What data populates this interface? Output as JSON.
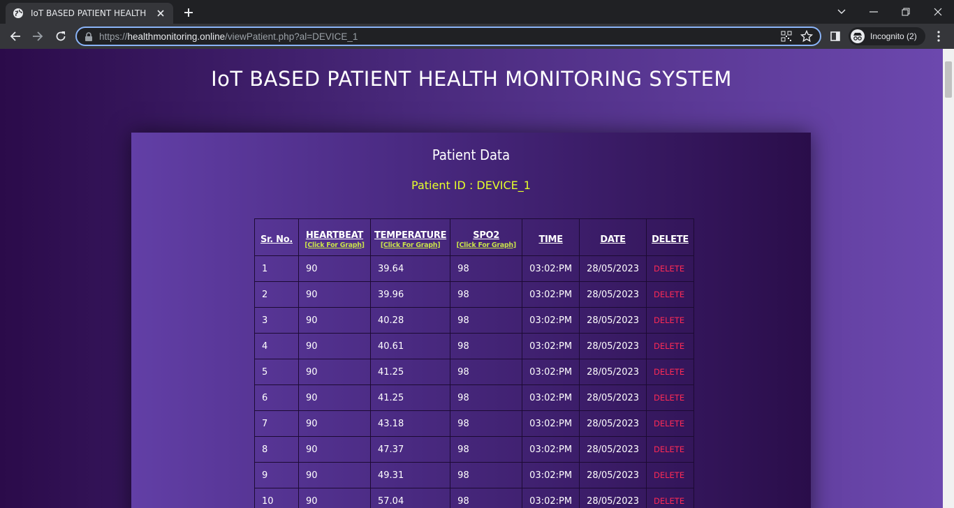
{
  "browser": {
    "tab_title": "IoT BASED PATIENT HEALTH MONITORING",
    "url_scheme": "https://",
    "url_host": "healthmonitoring.online",
    "url_path": "/viewPatient.php?al=DEVICE_1",
    "profile_label": "Incognito (2)"
  },
  "page": {
    "site_title": "IoT BASED PATIENT HEALTH MONITORING SYSTEM",
    "card_title": "Patient Data",
    "patient_id": "Patient ID : DEVICE_1"
  },
  "table": {
    "headers": {
      "sr": "Sr. No.",
      "heartbeat": "HEARTBEAT",
      "temperature": "TEMPERATURE",
      "spo2": "SPO2",
      "time": "TIME",
      "date": "DATE",
      "delete": "DELETE"
    },
    "graph_link": "[Click For Graph]",
    "rows": [
      {
        "sr": "1",
        "heartbeat": "90",
        "temperature": "39.64",
        "spo2": "98",
        "time": "03:02:PM",
        "date": "28/05/2023",
        "action": "DELETE"
      },
      {
        "sr": "2",
        "heartbeat": "90",
        "temperature": "39.96",
        "spo2": "98",
        "time": "03:02:PM",
        "date": "28/05/2023",
        "action": "DELETE"
      },
      {
        "sr": "3",
        "heartbeat": "90",
        "temperature": "40.28",
        "spo2": "98",
        "time": "03:02:PM",
        "date": "28/05/2023",
        "action": "DELETE"
      },
      {
        "sr": "4",
        "heartbeat": "90",
        "temperature": "40.61",
        "spo2": "98",
        "time": "03:02:PM",
        "date": "28/05/2023",
        "action": "DELETE"
      },
      {
        "sr": "5",
        "heartbeat": "90",
        "temperature": "41.25",
        "spo2": "98",
        "time": "03:02:PM",
        "date": "28/05/2023",
        "action": "DELETE"
      },
      {
        "sr": "6",
        "heartbeat": "90",
        "temperature": "41.25",
        "spo2": "98",
        "time": "03:02:PM",
        "date": "28/05/2023",
        "action": "DELETE"
      },
      {
        "sr": "7",
        "heartbeat": "90",
        "temperature": "43.18",
        "spo2": "98",
        "time": "03:02:PM",
        "date": "28/05/2023",
        "action": "DELETE"
      },
      {
        "sr": "8",
        "heartbeat": "90",
        "temperature": "47.37",
        "spo2": "98",
        "time": "03:02:PM",
        "date": "28/05/2023",
        "action": "DELETE"
      },
      {
        "sr": "9",
        "heartbeat": "90",
        "temperature": "49.31",
        "spo2": "98",
        "time": "03:02:PM",
        "date": "28/05/2023",
        "action": "DELETE"
      },
      {
        "sr": "10",
        "heartbeat": "90",
        "temperature": "57.04",
        "spo2": "98",
        "time": "03:02:PM",
        "date": "28/05/2023",
        "action": "DELETE"
      }
    ]
  },
  "icons": {
    "favicon": "globe-icon",
    "tab_close": "close-icon",
    "new_tab": "plus-icon",
    "back": "back-arrow-icon",
    "forward": "forward-arrow-icon",
    "reload": "reload-icon",
    "lock": "lock-icon",
    "qr": "qr-code-icon",
    "bookmark": "star-icon",
    "side_panel": "side-panel-icon",
    "incognito": "incognito-icon",
    "menu": "kebab-menu-icon"
  },
  "colors": {
    "accent_yellow": "#e6ff2a",
    "graph_link": "#c9e24a",
    "delete_red": "#ff2a55",
    "omnibox_focus": "#8ab4f8"
  }
}
